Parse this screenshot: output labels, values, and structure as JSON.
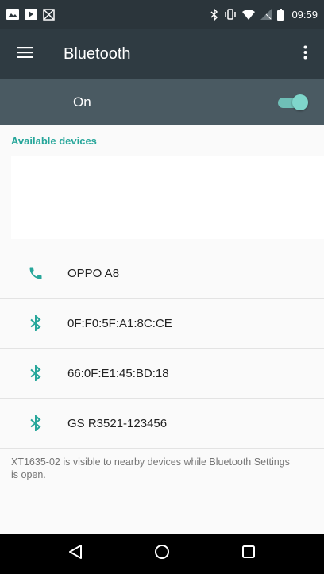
{
  "status_bar": {
    "time": "09:59",
    "left_icons": [
      "image-icon",
      "notification-icon",
      "blocked-icon"
    ],
    "right_icons": [
      "bluetooth-icon",
      "vibrate-icon",
      "wifi-icon",
      "no-signal-icon",
      "battery-icon"
    ]
  },
  "app_bar": {
    "title": "Bluetooth",
    "menu_icon": "hamburger-menu-icon",
    "more_icon": "more-vert-icon"
  },
  "master_switch": {
    "label": "On",
    "state": "on",
    "accent_color": "#7fd6cb"
  },
  "available_devices": {
    "header": "Available devices"
  },
  "paired_devices": [
    {
      "name": "OPPO A8",
      "icon": "phone-icon"
    },
    {
      "name": "0F:F0:5F:A1:8C:CE",
      "icon": "bluetooth-icon"
    },
    {
      "name": "66:0F:E1:45:BD:18",
      "icon": "bluetooth-icon"
    },
    {
      "name": "GS R3521-123456",
      "icon": "bluetooth-icon"
    }
  ],
  "visibility_note": "XT1635-02 is visible to nearby devices while Bluetooth Settings is open.",
  "nav_bar": {
    "back_icon": "back-triangle-icon",
    "home_icon": "home-circle-icon",
    "recents_icon": "recents-square-icon"
  },
  "colors": {
    "status_bar_bg": "#2b353b",
    "app_bar_bg": "#2f3b42",
    "master_row_bg": "#4a5a62",
    "accent": "#26a69a"
  }
}
